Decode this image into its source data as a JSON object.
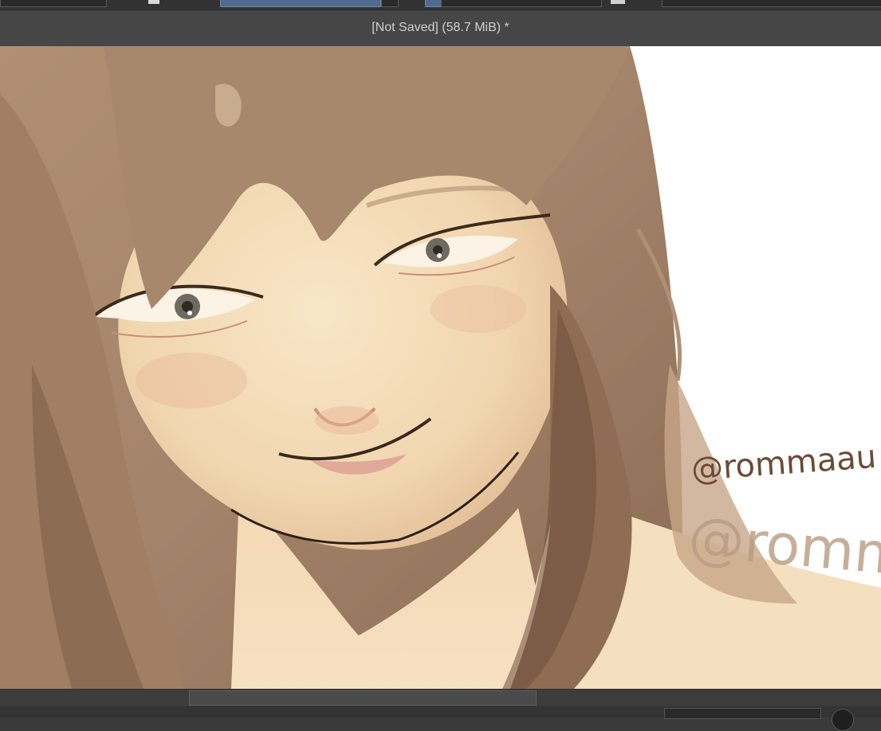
{
  "window": {
    "title": "[Not Saved]  (58.7 MiB) *"
  },
  "canvas": {
    "artwork": "digital painting",
    "watermark_1": "@rommaau",
    "watermark_2": "@romm",
    "colors": {
      "hair": "#a58468",
      "hair_shadow": "#7a5a44",
      "skin": "#f4dcb8",
      "background": "#ffffff",
      "ink": "#6b4a35"
    }
  },
  "scrollbar": {
    "horizontal_position": 0.36
  },
  "statusbar": {}
}
